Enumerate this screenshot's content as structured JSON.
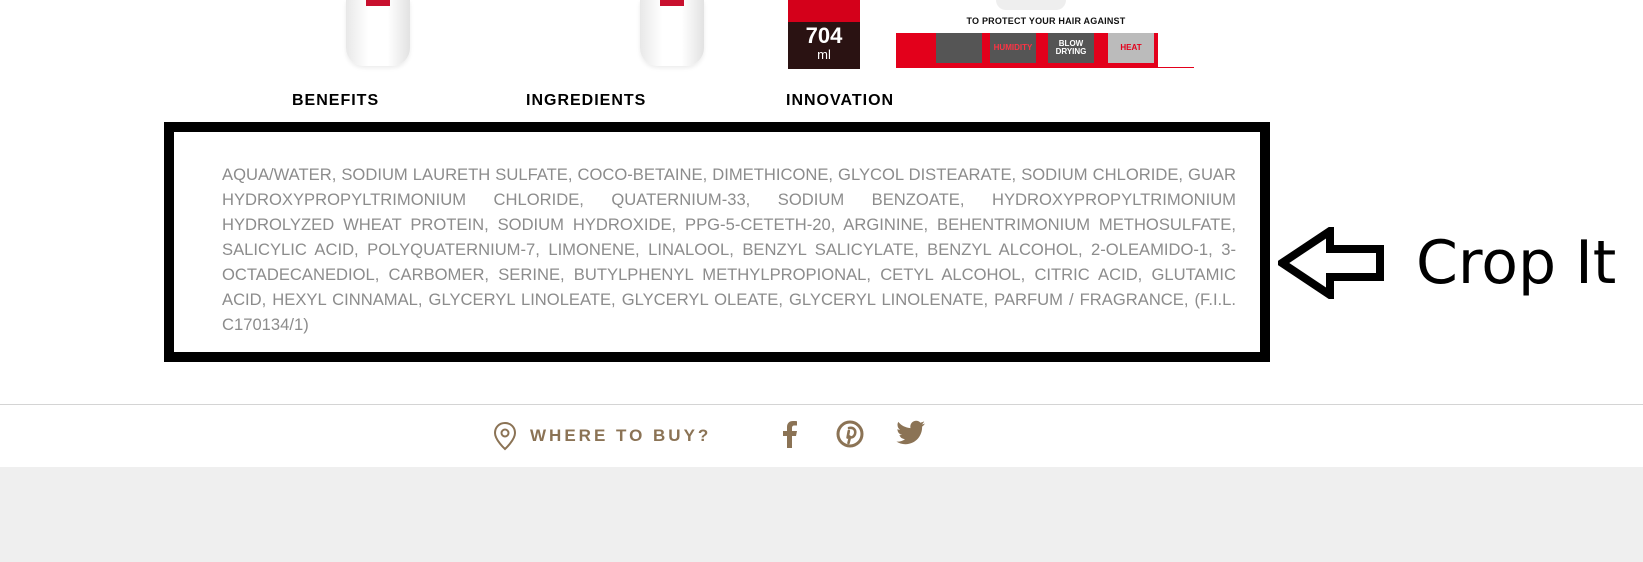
{
  "products": {
    "volume_number": "704",
    "volume_unit": "ml",
    "protect_text": "TO PROTECT YOUR HAIR AGAINST",
    "tiles": [
      "HUMIDITY",
      "BLOW DRYING",
      "HEAT"
    ]
  },
  "tabs": [
    {
      "label": "BENEFITS"
    },
    {
      "label": "INGREDIENTS"
    },
    {
      "label": "INNOVATION"
    }
  ],
  "ingredients": {
    "text": "AQUA/WATER, SODIUM LAURETH SULFATE, COCO-BETAINE, DIMETHICONE, GLYCOL DISTEARATE, SODIUM CHLORIDE, GUAR HYDROXYPROPYLTRIMONIUM CHLORIDE, QUATERNIUM-33, SODIUM BENZOATE, HYDROXYPROPYLTRIMONIUM HYDROLYZED WHEAT PROTEIN, SODIUM HYDROXIDE, PPG-5-CETETH-20, ARGININE, BEHENTRIMONIUM METHOSULFATE, SALICYLIC ACID, POLYQUATERNIUM-7, LIMONENE, LINALOOL, BENZYL SALICYLATE, BENZYL ALCOHOL, 2-OLEAMIDO-1, 3-OCTADECANEDIOL, CARBOMER, SERINE, BUTYLPHENYL METHYLPROPIONAL, CETYL ALCOHOL, CITRIC ACID, GLUTAMIC ACID, HEXYL CINNAMAL, GLYCERYL LINOLEATE, GLYCERYL OLEATE, GLYCERYL LINOLENATE, PARFUM / FRAGRANCE, (F.I.L. C170134/1)"
  },
  "annotation": {
    "label": "Crop It"
  },
  "footer": {
    "where_to_buy": "WHERE TO BUY?",
    "social": [
      "facebook-icon",
      "pinterest-icon",
      "twitter-icon"
    ]
  },
  "colors": {
    "accent_brown": "#8b7355",
    "brand_red": "#e3001b",
    "ingredient_text": "#8c8c8c"
  }
}
